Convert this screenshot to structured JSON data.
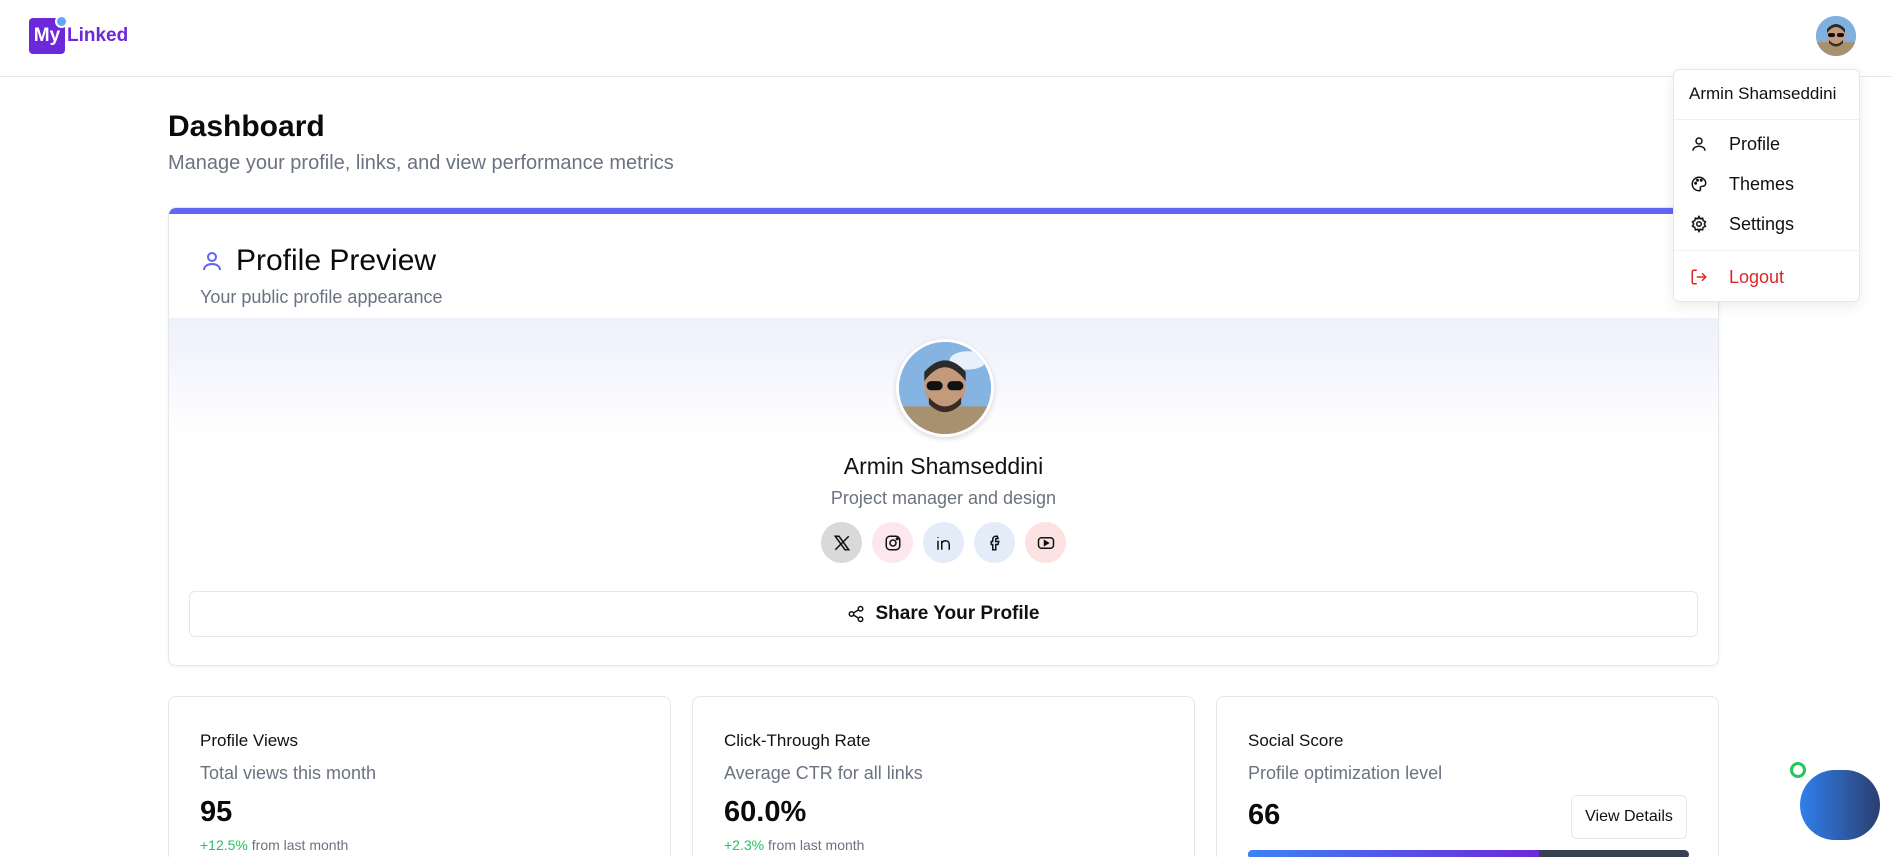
{
  "header": {
    "logo_my": "My",
    "logo_linked": "Linked"
  },
  "user_menu": {
    "name": "Armin Shamseddini",
    "items": [
      {
        "label": "Profile",
        "icon": "user-icon"
      },
      {
        "label": "Themes",
        "icon": "palette-icon"
      },
      {
        "label": "Settings",
        "icon": "gear-icon"
      }
    ],
    "logout_label": "Logout"
  },
  "page": {
    "title": "Dashboard",
    "subtitle": "Manage your profile, links, and view performance metrics"
  },
  "profile_card": {
    "title": "Profile Preview",
    "subtitle": "Your public profile appearance",
    "name": "Armin Shamseddini",
    "role": "Project manager and design",
    "socials": [
      "x-icon",
      "instagram-icon",
      "linkedin-icon",
      "facebook-icon",
      "youtube-icon"
    ],
    "share_label": "Share Your Profile"
  },
  "stats": [
    {
      "title": "Profile Views",
      "subtitle": "Total views this month",
      "value": "95",
      "trend": "+12.5%",
      "trend_suffix": "from last month"
    },
    {
      "title": "Click-Through Rate",
      "subtitle": "Average CTR for all links",
      "value": "60.0%",
      "trend": "+2.3%",
      "trend_suffix": "from last month"
    },
    {
      "title": "Social Score",
      "subtitle": "Profile optimization level",
      "value": "66",
      "button": "View Details",
      "progress": 0.66
    }
  ],
  "colors": {
    "brand": "#6d28d9",
    "accent": "#6366f1",
    "danger": "#dc2626",
    "success": "#22c55e"
  }
}
